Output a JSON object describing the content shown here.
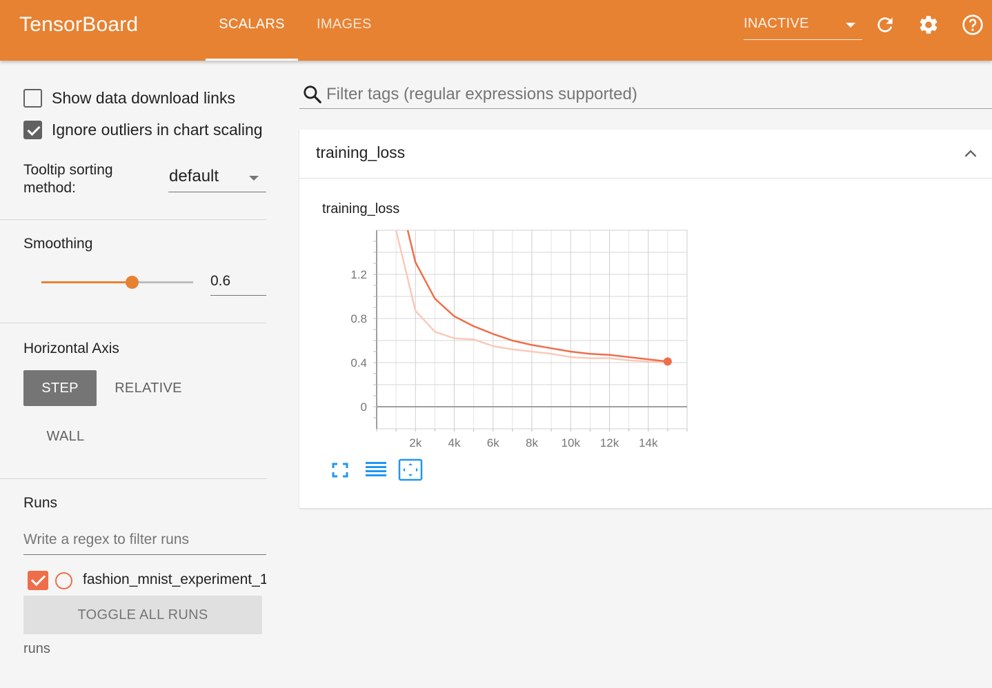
{
  "header": {
    "brand": "TensorBoard",
    "tabs": [
      {
        "label": "SCALARS",
        "active": true
      },
      {
        "label": "IMAGES",
        "active": false
      }
    ],
    "reload_status": "INACTIVE",
    "icons": [
      "refresh-icon",
      "settings-icon",
      "help-icon"
    ],
    "accent_color": "#e78232"
  },
  "sidebar": {
    "show_download_links": {
      "label": "Show data download links",
      "checked": false
    },
    "ignore_outliers": {
      "label": "Ignore outliers in chart scaling",
      "checked": true
    },
    "tooltip_sorting": {
      "label": "Tooltip sorting method:",
      "value": "default"
    },
    "smoothing": {
      "title": "Smoothing",
      "value": "0.6",
      "fraction": 0.6
    },
    "horizontal_axis": {
      "title": "Horizontal Axis",
      "options": [
        "STEP",
        "RELATIVE",
        "WALL"
      ],
      "selected": "STEP"
    },
    "runs": {
      "title": "Runs",
      "filter_placeholder": "Write a regex to filter runs",
      "items": [
        {
          "name": "fashion_mnist_experiment_1",
          "checked": true,
          "color": "#ee6e4a"
        }
      ],
      "toggle_all_label": "TOGGLE ALL RUNS",
      "directory": "runs"
    }
  },
  "main": {
    "tag_filter_placeholder": "Filter tags (regular expressions supported)",
    "card": {
      "title": "training_loss",
      "chart_title": "training_loss",
      "toolbar_icons": [
        "fullscreen-icon",
        "log-scale-icon",
        "fit-domain-icon"
      ]
    }
  },
  "chart_data": {
    "type": "line",
    "title": "training_loss",
    "xlabel": "",
    "ylabel": "",
    "x_ticks": [
      "2k",
      "4k",
      "6k",
      "8k",
      "10k",
      "12k",
      "14k"
    ],
    "x_tick_values": [
      2000,
      4000,
      6000,
      8000,
      10000,
      12000,
      14000
    ],
    "y_ticks": [
      "0",
      "0.4",
      "0.8",
      "1.2"
    ],
    "y_tick_values": [
      0,
      0.4,
      0.8,
      1.2
    ],
    "xlim": [
      0,
      16000
    ],
    "ylim": [
      -0.2,
      1.6
    ],
    "grid": true,
    "series": [
      {
        "name": "fashion_mnist_experiment_1",
        "role": "raw",
        "color": "#f9c9b9",
        "x": [
          1000,
          2000,
          3000,
          4000,
          5000,
          6000,
          7000,
          8000,
          9000,
          10000,
          11000,
          12000,
          13000,
          14000,
          15000
        ],
        "y": [
          1.6,
          0.87,
          0.68,
          0.62,
          0.61,
          0.55,
          0.52,
          0.5,
          0.48,
          0.45,
          0.44,
          0.44,
          0.42,
          0.41,
          0.4
        ]
      },
      {
        "name": "fashion_mnist_experiment_1",
        "role": "smoothed",
        "color": "#ee6e4a",
        "x": [
          1600,
          2000,
          3000,
          4000,
          5000,
          6000,
          7000,
          8000,
          9000,
          10000,
          11000,
          12000,
          13000,
          14000,
          15000
        ],
        "y": [
          1.6,
          1.31,
          0.98,
          0.82,
          0.73,
          0.66,
          0.6,
          0.56,
          0.53,
          0.5,
          0.48,
          0.47,
          0.45,
          0.43,
          0.41
        ]
      }
    ]
  }
}
